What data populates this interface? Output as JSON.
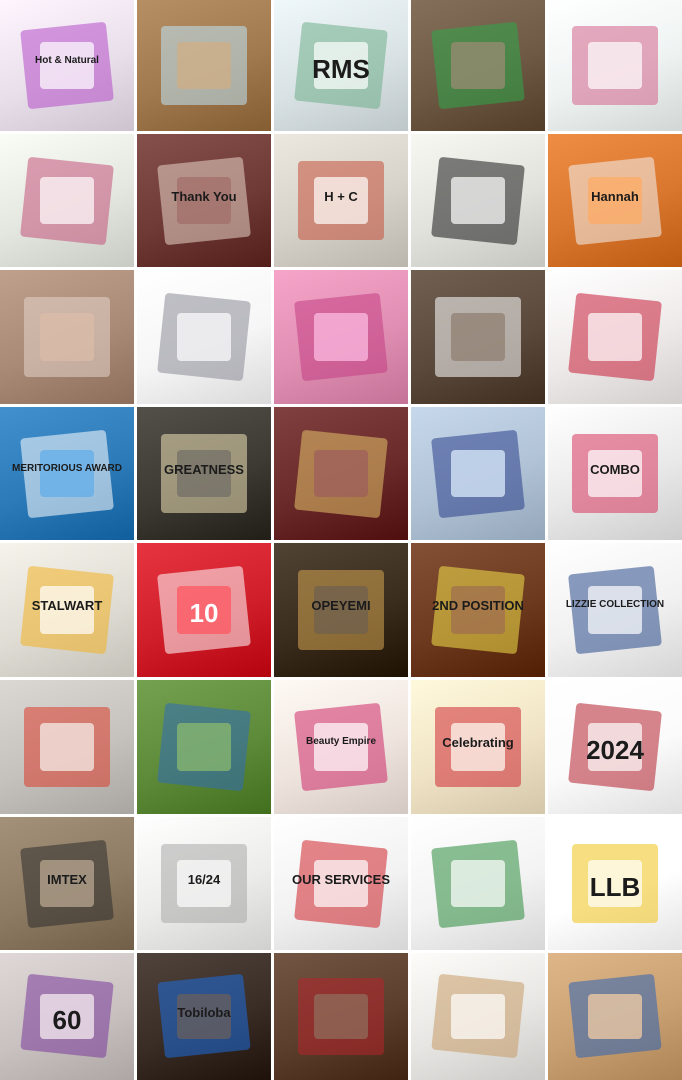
{
  "grid": {
    "columns": 5,
    "rows": 8
  },
  "tiles": [
    {
      "id": "r1c1",
      "subject": "skincare-bottles",
      "bg": "#e8dfea",
      "accent": "#b44cc9",
      "text": "Hot & Natural"
    },
    {
      "id": "r1c2",
      "subject": "business-cards",
      "bg": "#a07a4e",
      "accent": "#bfe4f6",
      "text": ""
    },
    {
      "id": "r1c3",
      "subject": "printed-mugs",
      "bg": "#d9e2e4",
      "accent": "#6fae8b",
      "text": "RMS"
    },
    {
      "id": "r1c4",
      "subject": "keychains",
      "bg": "#6e5a44",
      "accent": "#2ea84a",
      "text": ""
    },
    {
      "id": "r1c5",
      "subject": "floral-gift-boxes",
      "bg": "#eef3f2",
      "accent": "#d3648c",
      "text": ""
    },
    {
      "id": "r2c1",
      "subject": "floral-gift-boxes",
      "bg": "#e3e7df",
      "accent": "#c5527c",
      "text": ""
    },
    {
      "id": "r2c2",
      "subject": "thank-you-notebooks",
      "bg": "#6f3a35",
      "accent": "#e8d6c9",
      "text": "Thank You"
    },
    {
      "id": "r2c3",
      "subject": "monogram-mug",
      "bg": "#d7d2c9",
      "accent": "#c4513a",
      "text": "H + C"
    },
    {
      "id": "r2c4",
      "subject": "branded-pens",
      "bg": "#e2e2dd",
      "accent": "#1a1a1a",
      "text": ""
    },
    {
      "id": "r2c5",
      "subject": "photo-keychains",
      "bg": "#d9772f",
      "accent": "#f2f2f2",
      "text": "Hannah"
    },
    {
      "id": "r3c1",
      "subject": "photo-frames",
      "bg": "#a98a76",
      "accent": "#e3d4ca",
      "text": ""
    },
    {
      "id": "r3c2",
      "subject": "payment-receipt",
      "bg": "#f6f6f7",
      "accent": "#8a8a95",
      "text": ""
    },
    {
      "id": "r3c3",
      "subject": "portrait-print",
      "bg": "#e08fb3",
      "accent": "#c23e84",
      "text": ""
    },
    {
      "id": "r3c4",
      "subject": "invoice-booklets",
      "bg": "#5b4a3c",
      "accent": "#ffffff",
      "text": ""
    },
    {
      "id": "r3c5",
      "subject": "red-business-cards",
      "bg": "#efeaea",
      "accent": "#c61d39",
      "text": ""
    },
    {
      "id": "r4c1",
      "subject": "acrylic-award",
      "bg": "#2c7ab8",
      "accent": "#ffffff",
      "text": "MERITORIOUS AWARD"
    },
    {
      "id": "r4c2",
      "subject": "framed-word-art",
      "bg": "#3d3a33",
      "accent": "#efe2b6",
      "text": "GREATNESS"
    },
    {
      "id": "r4c3",
      "subject": "oval-photo-frame",
      "bg": "#6b2a2a",
      "accent": "#e3c36a",
      "text": ""
    },
    {
      "id": "r4c4",
      "subject": "birthday-portrait-display",
      "bg": "#b0c2d5",
      "accent": "#2b3f8c",
      "text": ""
    },
    {
      "id": "r4c5",
      "subject": "branded-tote-bag",
      "bg": "#e9e9e9",
      "accent": "#d9345e",
      "text": "COMBO"
    },
    {
      "id": "r5c1",
      "subject": "stalwart-award-plates",
      "bg": "#e0ddd5",
      "accent": "#f2b324",
      "text": "STALWART"
    },
    {
      "id": "r5c2",
      "subject": "custom-jersey",
      "bg": "#d01f2b",
      "accent": "#ffffff",
      "text": "10"
    },
    {
      "id": "r5c3",
      "subject": "name-frame",
      "bg": "#3b2d1e",
      "accent": "#d3a451",
      "text": "OPEYEMI"
    },
    {
      "id": "r5c4",
      "subject": "church-award-plaque",
      "bg": "#6d3a1f",
      "accent": "#f3e24a",
      "text": "2ND POSITION"
    },
    {
      "id": "r5c5",
      "subject": "branded-tote-bag",
      "bg": "#f1f1f1",
      "accent": "#2a4a8a",
      "text": "LIZZIE COLLECTION"
    },
    {
      "id": "r6c1",
      "subject": "card-fan",
      "bg": "#c5c2be",
      "accent": "#dd3c2b",
      "text": ""
    },
    {
      "id": "r6c2",
      "subject": "photo-print",
      "bg": "#5e8b3a",
      "accent": "#2f6bb8",
      "text": ""
    },
    {
      "id": "r6c3",
      "subject": "salon-banner",
      "bg": "#efe4de",
      "accent": "#cf2a6a",
      "text": "Beauty Empire"
    },
    {
      "id": "r6c4",
      "subject": "celebration-booklets",
      "bg": "#f0e3c5",
      "accent": "#d02a35",
      "text": "Celebrating"
    },
    {
      "id": "r6c5",
      "subject": "church-posters",
      "bg": "#fbfbfb",
      "accent": "#b3202c",
      "text": "2024"
    },
    {
      "id": "r7c1",
      "subject": "custom-phone-cases",
      "bg": "#8d7b63",
      "accent": "#2d2d2d",
      "text": "IMTEX"
    },
    {
      "id": "r7c2",
      "subject": "marble-vinyl-sheets",
      "bg": "#ececea",
      "accent": "#aaaaaa",
      "text": "16/24"
    },
    {
      "id": "r7c3",
      "subject": "services-flyer",
      "bg": "#f2f2f2",
      "accent": "#d0232c",
      "text": "OUR SERVICES"
    },
    {
      "id": "r7c4",
      "subject": "green-flyers",
      "bg": "#f3f3f3",
      "accent": "#2c8a3d",
      "text": ""
    },
    {
      "id": "r7c5",
      "subject": "graduation-stoles",
      "bg": "#ffffff",
      "accent": "#f0c419",
      "text": "LLB"
    },
    {
      "id": "r8c1",
      "subject": "birthday-flyers",
      "bg": "#c9c2c0",
      "accent": "#7a3a9c",
      "text": "60"
    },
    {
      "id": "r8c2",
      "subject": "custom-bottles",
      "bg": "#3a2d26",
      "accent": "#1e6de0",
      "text": "Tobiloba"
    },
    {
      "id": "r8c3",
      "subject": "trophy-awards",
      "bg": "#5c3f2c",
      "accent": "#b7252e",
      "text": ""
    },
    {
      "id": "r8c4",
      "subject": "branded-pens-cups",
      "bg": "#e7e6e3",
      "accent": "#c79a66",
      "text": ""
    },
    {
      "id": "r8c5",
      "subject": "qr-display-stands",
      "bg": "#c9a072",
      "accent": "#2c63b6",
      "text": ""
    }
  ]
}
